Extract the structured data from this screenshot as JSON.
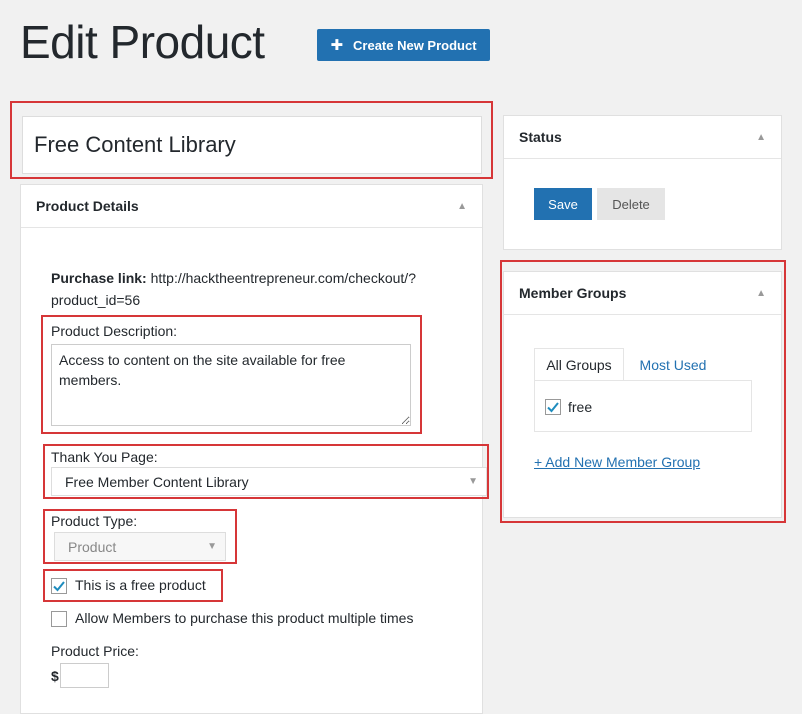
{
  "header": {
    "title": "Edit Product",
    "create_button": "Create New Product"
  },
  "product": {
    "title": "Free Content Library"
  },
  "product_details": {
    "heading": "Product Details",
    "purchase_link_label": "Purchase link:",
    "purchase_link_line1": "http://hacktheentrepreneur.com/checkout/?",
    "purchase_link_line2": "product_id=56",
    "description_label": "Product Description:",
    "description_value": "Access to content on the site available for free members.",
    "thank_you_label": "Thank You Page:",
    "thank_you_value": "Free Member Content Library",
    "type_label": "Product Type:",
    "type_value": "Product",
    "free_label": "This is a free product",
    "free_checked": true,
    "multiple_label": "Allow Members to purchase this product multiple times",
    "multiple_checked": false,
    "price_label": "Product Price:",
    "currency": "$",
    "price_value": ""
  },
  "status": {
    "heading": "Status",
    "save": "Save",
    "delete": "Delete"
  },
  "member_groups": {
    "heading": "Member Groups",
    "tabs": [
      "All Groups",
      "Most Used"
    ],
    "groups": [
      {
        "label": "free",
        "checked": true
      }
    ],
    "add_link": "+ Add New Member Group"
  },
  "colors": {
    "primary": "#2271b1",
    "highlight": "#d63638"
  }
}
